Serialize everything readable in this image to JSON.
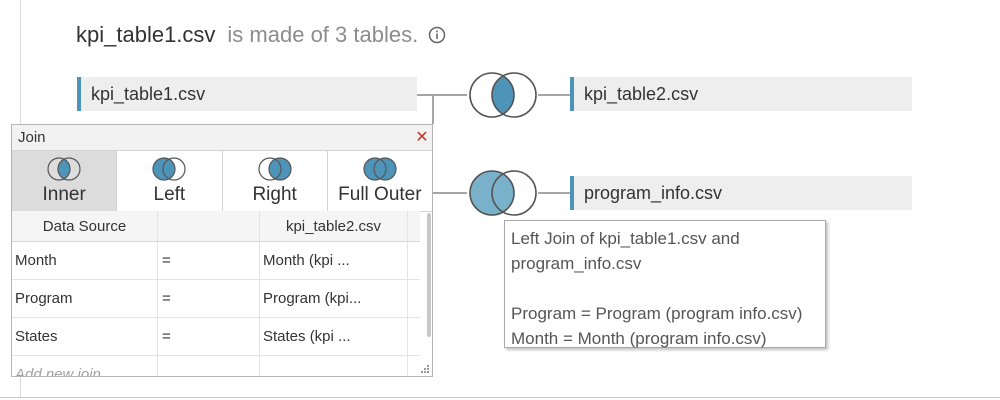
{
  "header": {
    "file_name": "kpi_table1.csv",
    "description": "is made of 3 tables."
  },
  "tables": {
    "left": "kpi_table1.csv",
    "right_top": "kpi_table2.csv",
    "right_bottom": "program_info.csv"
  },
  "colors": {
    "accent": "#4e94b8",
    "venn_fill": "#4e94b8",
    "venn_fill_light": "#78b1c9",
    "close": "#c0392b"
  },
  "join_dialog": {
    "title": "Join",
    "join_types": [
      {
        "label": "Inner",
        "icon": "inner-join-icon",
        "selected": true
      },
      {
        "label": "Left",
        "icon": "left-join-icon",
        "selected": false
      },
      {
        "label": "Right",
        "icon": "right-join-icon",
        "selected": false
      },
      {
        "label": "Full Outer",
        "icon": "full-outer-join-icon",
        "selected": false
      }
    ],
    "columns": {
      "left": "Data Source",
      "right": "kpi_table2.csv"
    },
    "clauses": [
      {
        "left": "Month",
        "op": "=",
        "right": "Month (kpi ..."
      },
      {
        "left": "Program",
        "op": "=",
        "right": "Program (kpi..."
      },
      {
        "left": "States",
        "op": "=",
        "right": "States (kpi ..."
      }
    ],
    "add_placeholder": "Add new join ..."
  },
  "tooltip": {
    "line1": "Left Join of kpi_table1.csv and",
    "line2": "program_info.csv",
    "line3": "Program = Program (program info.csv)",
    "line4": "Month = Month (program info.csv)"
  }
}
